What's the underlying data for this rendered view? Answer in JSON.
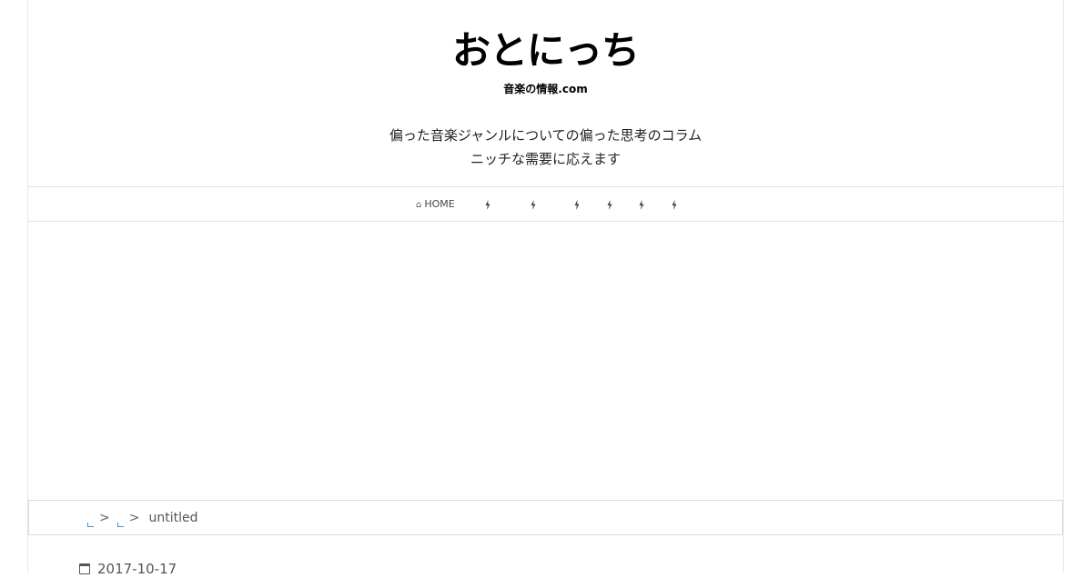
{
  "header": {
    "title": "おとにっち",
    "subtitle": "音楽の情報.com",
    "description": [
      "偏った音楽ジャンルについての偏った思考のコラム",
      "ニッチな需要に応えます"
    ]
  },
  "nav": {
    "home_label": "HOME",
    "home_icon": "home-icon",
    "item_icon": "bolt-icon",
    "item_count": 6
  },
  "breadcrumb": {
    "separator": ">",
    "current": "untitled"
  },
  "post": {
    "date": "2017-10-17",
    "date_icon": "calendar-icon"
  },
  "colors": {
    "text": "#222222",
    "border": "#e2e2e2",
    "link": "#4a90c8"
  }
}
